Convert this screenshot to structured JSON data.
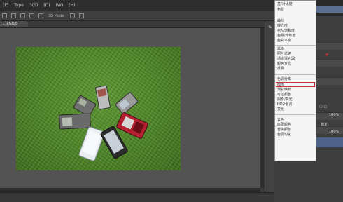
{
  "menubar": {
    "items": [
      "(F)",
      "Type",
      "3(S)",
      "(D)",
      "(W)",
      "(H)"
    ]
  },
  "options_bar": {
    "mode_label": "3D Mode:"
  },
  "document": {
    "tab_label": "1, RGB/8"
  },
  "context_menu": {
    "items": [
      "亮/对比度",
      "色阶",
      "曲线",
      "曝光度",
      "自然饱和度",
      "色相/饱和度",
      "色彩平衡",
      "黑白",
      "照片滤镜",
      "通道混合器",
      "颜色查找",
      "反相",
      "色调分离",
      "阈值",
      "渐变映射",
      "可选颜色",
      "阴影/高光",
      "HDR色调",
      "变化",
      "去色",
      "匹配颜色",
      "替换颜色",
      "色调均化"
    ],
    "highlighted_item": "阴影/高光"
  },
  "right_panel": {
    "opacity_value": "100%",
    "fill_value": "100%",
    "lock_label": "锁定:"
  },
  "icons": [
    "brush-icon",
    "layer-thumbnail-icon",
    "lock-icon",
    "checkbox-icon"
  ]
}
